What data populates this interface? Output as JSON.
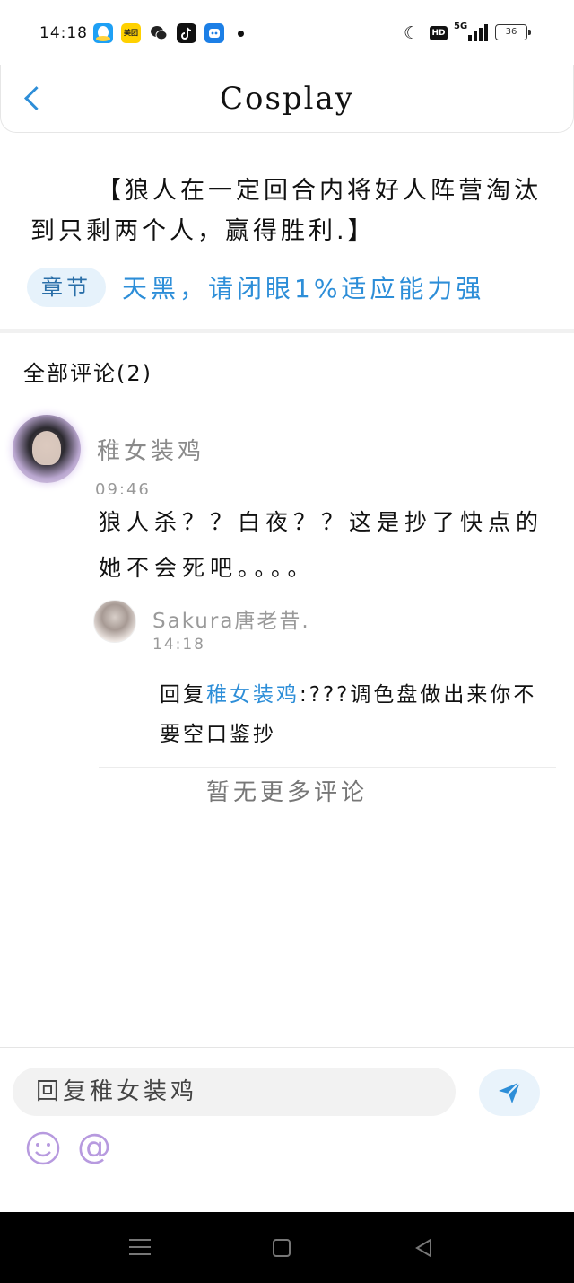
{
  "status_bar": {
    "time": "14:18",
    "app_meituan": "美团",
    "network": "5G",
    "hd": "HD",
    "battery": "36"
  },
  "header": {
    "title": "Cosplay"
  },
  "chapter": {
    "intro": "【狼人在一定回合内将好人阵营淘汰到只剩两个人，赢得胜利.】",
    "tag": "章节",
    "link": "天黑，请闭眼1%适应能力强"
  },
  "comments": {
    "header": "全部评论(2)",
    "main": {
      "author": "稚女装鸡",
      "time": "09:46",
      "text": "狼人杀？？白夜？？这是抄了快点的她不会死吧。。。。"
    },
    "reply": {
      "author": "Sakura唐老昔.",
      "time": "14:18",
      "prefix": "回复",
      "mention": "稚女装鸡",
      "text": ":???调色盘做出来你不要空口鉴抄"
    },
    "no_more": "暂无更多评论"
  },
  "input": {
    "placeholder": "回复稚女装鸡",
    "at_symbol": "@"
  },
  "icons": {
    "back": "chevron-left-icon",
    "send": "send-icon",
    "emoji": "smiley-icon",
    "at": "at-icon"
  },
  "colors": {
    "accent": "#2d8ed8",
    "emoji_purple": "#b79adf"
  }
}
